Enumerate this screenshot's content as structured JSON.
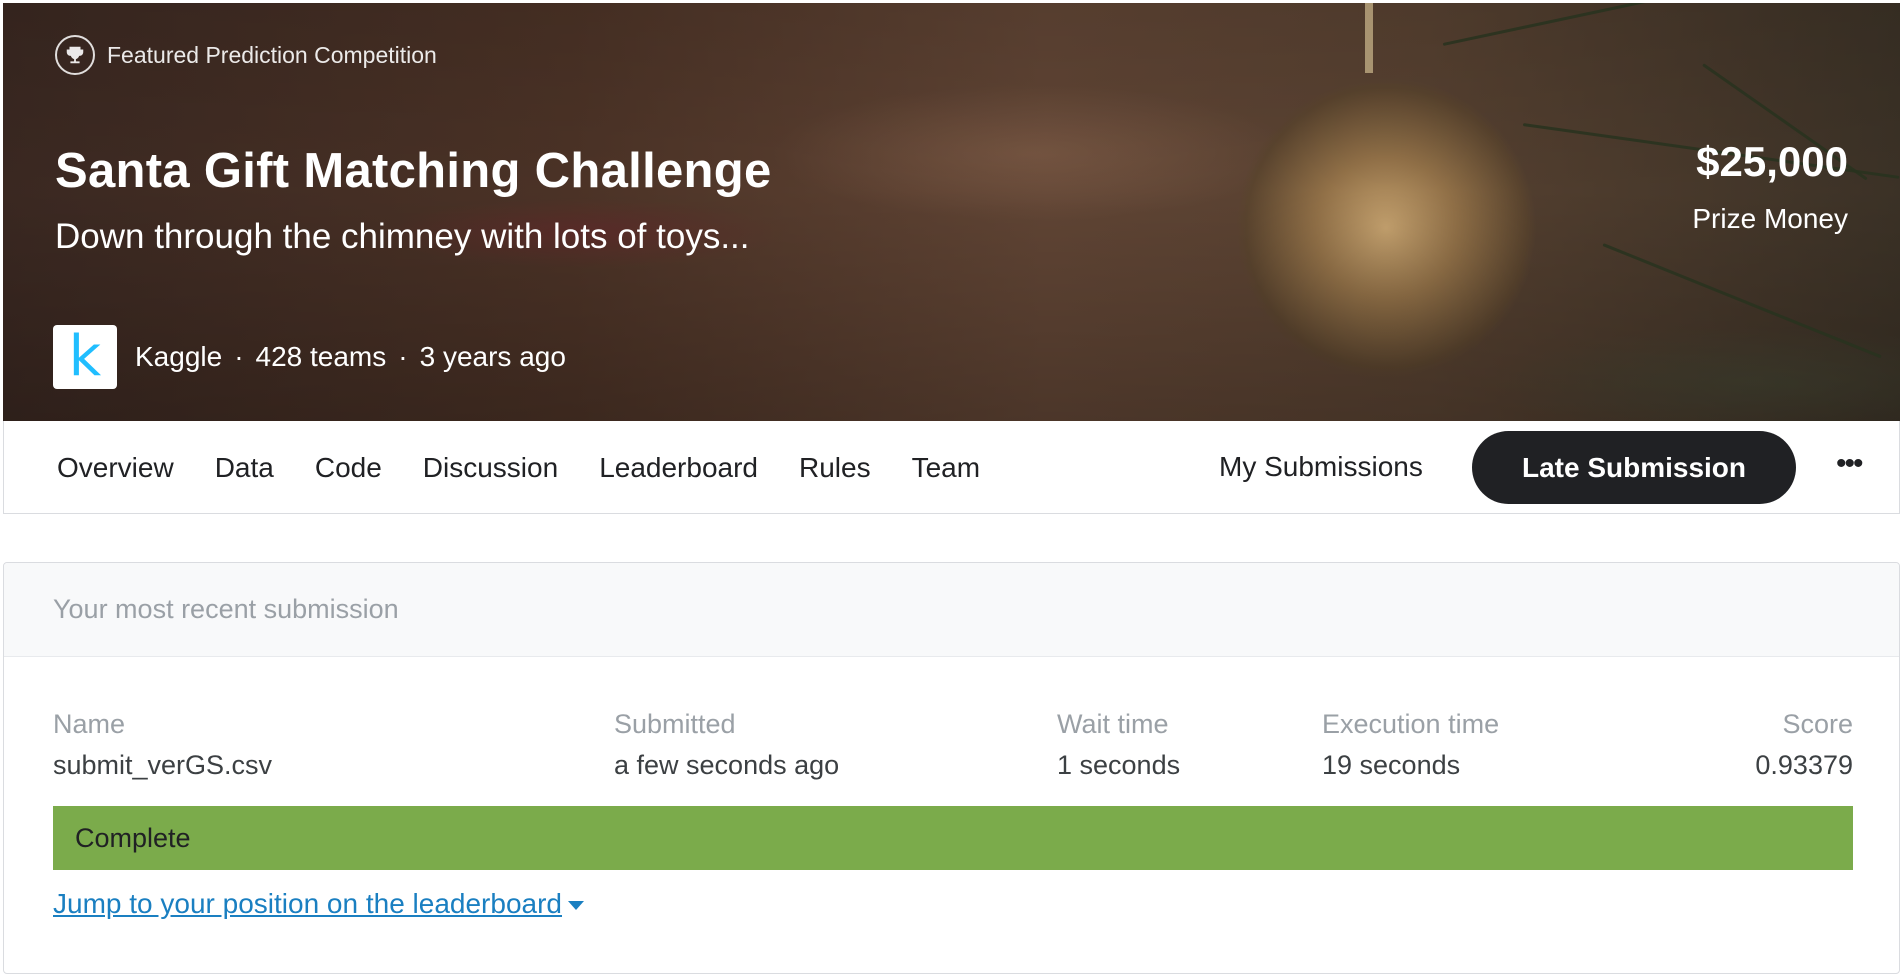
{
  "hero": {
    "featured_label": "Featured Prediction Competition",
    "title": "Santa Gift Matching Challenge",
    "subtitle": "Down through the chimney with lots of toys...",
    "host_logo_letter": "k",
    "host": "Kaggle",
    "teams": "428 teams",
    "age": "3 years ago",
    "separator": "·",
    "prize_amount": "$25,000",
    "prize_label": "Prize Money"
  },
  "nav": {
    "tabs": [
      "Overview",
      "Data",
      "Code",
      "Discussion",
      "Leaderboard",
      "Rules",
      "Team"
    ],
    "my_submissions": "My Submissions",
    "late_submission": "Late Submission",
    "more": "•••"
  },
  "submission": {
    "header": "Your most recent submission",
    "columns": {
      "name": {
        "label": "Name",
        "value": "submit_verGS.csv"
      },
      "submitted": {
        "label": "Submitted",
        "value": "a few seconds ago"
      },
      "wait_time": {
        "label": "Wait time",
        "value": "1 seconds"
      },
      "execution_time": {
        "label": "Execution time",
        "value": "19 seconds"
      },
      "score": {
        "label": "Score",
        "value": "0.93379"
      }
    },
    "status": "Complete",
    "jump_link": "Jump to your position on the leaderboard"
  },
  "colors": {
    "status_green": "#7bab4b",
    "link_blue": "#1a7fc1",
    "button_dark": "#202124",
    "kaggle_blue": "#20beff"
  },
  "icons": {
    "featured": "trophy-icon",
    "jump_link": "caret-down-icon",
    "more": "more-horizontal-icon"
  }
}
